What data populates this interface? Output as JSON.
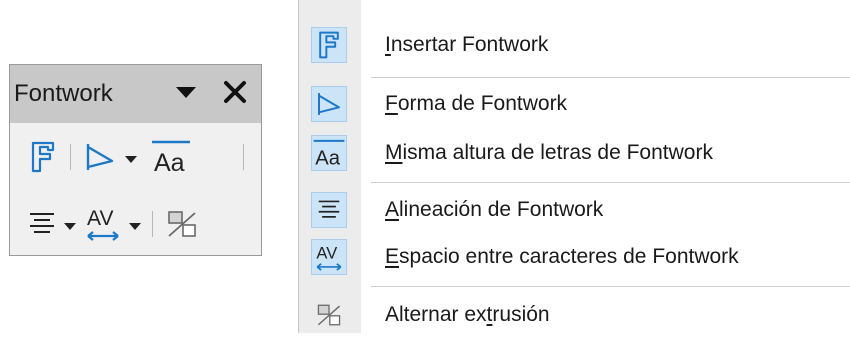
{
  "toolbar": {
    "title": "Fontwork"
  },
  "icons": {
    "insert_fontwork": "fontwork-letter-f-icon",
    "fontwork_shape": "fontwork-shape-icon",
    "same_height": "same-letter-heights-icon",
    "alignment": "align-center-lines-icon",
    "char_spacing": "character-spacing-icon",
    "extrusion": "toggle-extrusion-icon"
  },
  "menu": {
    "items": [
      {
        "pre": "",
        "key": "I",
        "post": "nsertar Fontwork"
      },
      {
        "pre": "",
        "key": "F",
        "post": "orma de Fontwork"
      },
      {
        "pre": "",
        "key": "M",
        "post": "isma altura de letras de Fontwork"
      },
      {
        "pre": "",
        "key": "A",
        "post": "lineación de Fontwork"
      },
      {
        "pre": "",
        "key": "E",
        "post": "spacio entre caracteres de Fontwork"
      },
      {
        "pre": "Alternar ex",
        "key": "t",
        "post": "rusión"
      }
    ]
  },
  "colors": {
    "icon_blue": "#1e78c8",
    "highlight": "#cce4f7",
    "title_bar": "#c8c8c8"
  }
}
